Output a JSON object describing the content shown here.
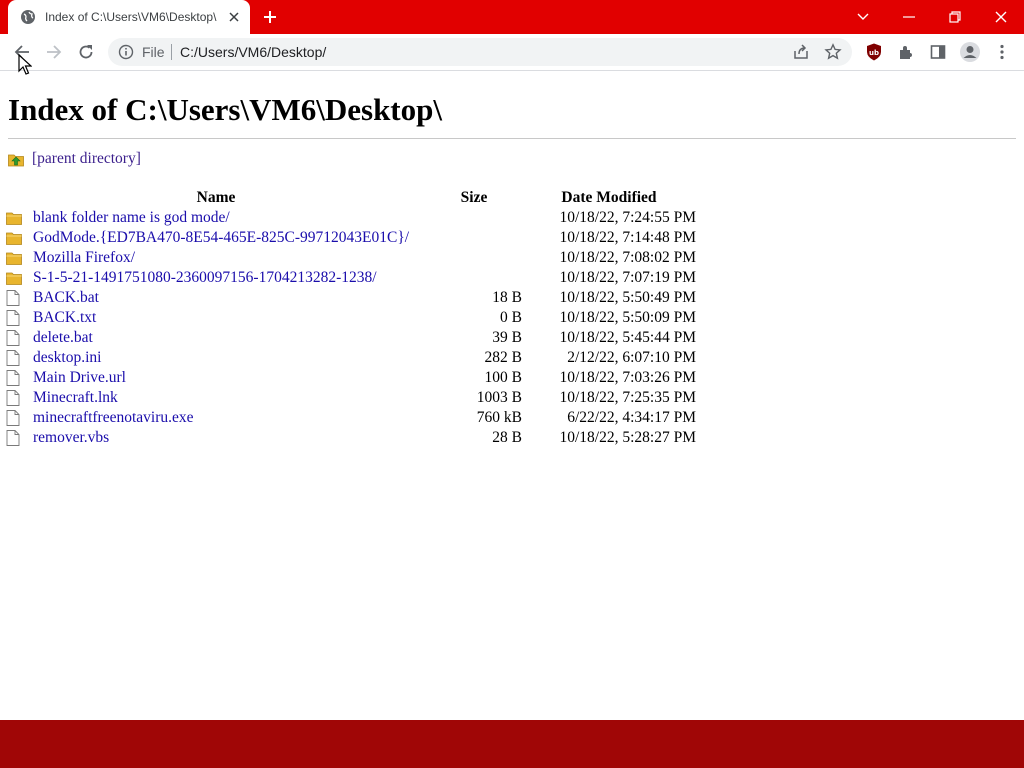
{
  "colors": {
    "tabstrip": "#e10000",
    "bottombar": "#a00606",
    "link": "#1a0dab",
    "visited_link": "#3b1f8c",
    "folder": "#e8b52e"
  },
  "tab": {
    "title": "Index of C:\\Users\\VM6\\Desktop\\",
    "favicon": "globe-icon",
    "close_icon": "close-icon"
  },
  "toolbar": {
    "scheme_label": "File",
    "url": "C:/Users/VM6/Desktop/",
    "icons": [
      "back-icon",
      "forward-icon",
      "reload-icon",
      "info-icon",
      "share-icon",
      "star-icon",
      "ublock-icon",
      "extensions-icon",
      "sidepanel-icon",
      "profile-icon",
      "menu-icon"
    ]
  },
  "page": {
    "heading": "Index of C:\\Users\\VM6\\Desktop\\",
    "parent_label": "[parent directory]",
    "columns": {
      "name": "Name",
      "size": "Size",
      "date": "Date Modified"
    },
    "entries": [
      {
        "name": "blank folder name is god mode/",
        "size": "",
        "date": "10/18/22, 7:24:55 PM",
        "type": "folder"
      },
      {
        "name": "GodMode.{ED7BA470-8E54-465E-825C-99712043E01C}/",
        "size": "",
        "date": "10/18/22, 7:14:48 PM",
        "type": "folder"
      },
      {
        "name": "Mozilla Firefox/",
        "size": "",
        "date": "10/18/22, 7:08:02 PM",
        "type": "folder"
      },
      {
        "name": "S-1-5-21-1491751080-2360097156-1704213282-1238/",
        "size": "",
        "date": "10/18/22, 7:07:19 PM",
        "type": "folder"
      },
      {
        "name": "BACK.bat",
        "size": "18 B",
        "date": "10/18/22, 5:50:49 PM",
        "type": "file"
      },
      {
        "name": "BACK.txt",
        "size": "0 B",
        "date": "10/18/22, 5:50:09 PM",
        "type": "file"
      },
      {
        "name": "delete.bat",
        "size": "39 B",
        "date": "10/18/22, 5:45:44 PM",
        "type": "file"
      },
      {
        "name": "desktop.ini",
        "size": "282 B",
        "date": "2/12/22, 6:07:10 PM",
        "type": "file"
      },
      {
        "name": "Main Drive.url",
        "size": "100 B",
        "date": "10/18/22, 7:03:26 PM",
        "type": "file"
      },
      {
        "name": "Minecraft.lnk",
        "size": "1003 B",
        "date": "10/18/22, 7:25:35 PM",
        "type": "file"
      },
      {
        "name": "minecraftfreenotaviru.exe",
        "size": "760 kB",
        "date": "6/22/22, 4:34:17 PM",
        "type": "file"
      },
      {
        "name": "remover.vbs",
        "size": "28 B",
        "date": "10/18/22, 5:28:27 PM",
        "type": "file"
      }
    ]
  }
}
